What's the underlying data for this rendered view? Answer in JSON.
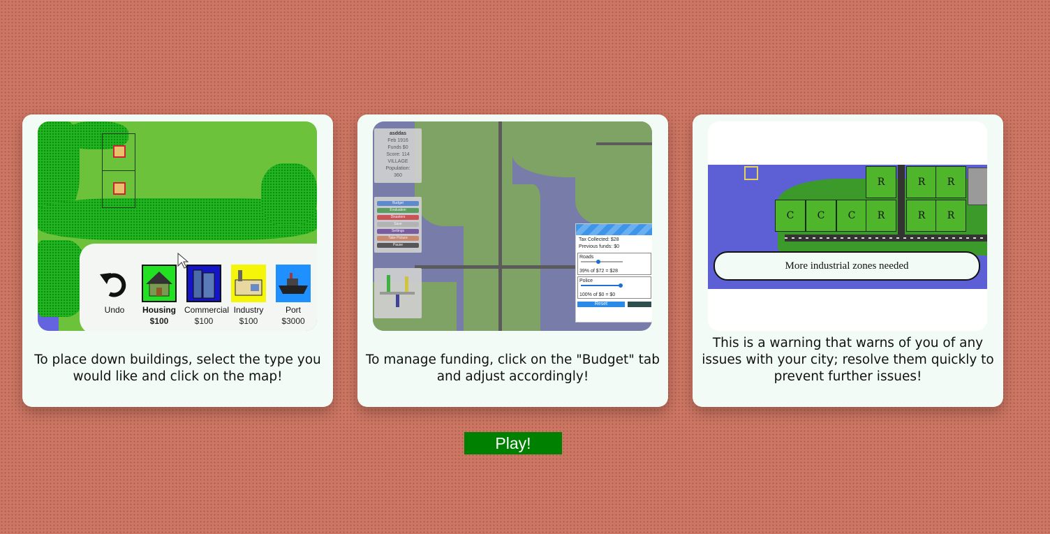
{
  "cards": [
    {
      "caption": "To place down buildings, select the type you would like and click on the map!",
      "toolbar": [
        {
          "label": "Undo",
          "price": ""
        },
        {
          "label": "Housing",
          "price": "$100"
        },
        {
          "label": "Commercial",
          "price": "$100"
        },
        {
          "label": "Industry",
          "price": "$100"
        },
        {
          "label": "Port",
          "price": "$3000"
        }
      ]
    },
    {
      "caption": "To manage funding, click on the \"Budget\" tab and adjust accordingly!",
      "info": {
        "name": "asddas",
        "date": "Feb 1916",
        "funds": "Funds $0",
        "score": "Score: 114",
        "level": "VILLAGE",
        "population_label": "Population:",
        "population": "360"
      },
      "menu": [
        "Budget",
        "Evaluation",
        "Disasters",
        "Save",
        "Settings",
        "Take Picture",
        "Pause"
      ],
      "budget": {
        "tax": "Tax Collected: $28",
        "previous": "Previous funds: $0",
        "roads_label": "Roads",
        "roads_value": "39% of $72 = $28",
        "police_label": "Police",
        "police_value": "100% of $0 = $0",
        "reset": "Reset"
      }
    },
    {
      "caption": "This is a warning that warns of you of any issues with your city; resolve them quickly to prevent further issues!",
      "warning": "More industrial zones needed",
      "commercial_mark": "C",
      "residential_mark": "R"
    }
  ],
  "play_label": "Play!",
  "colors": {
    "background": "#cd7664",
    "card": "#f2fbf6",
    "play_button": "#008000"
  }
}
